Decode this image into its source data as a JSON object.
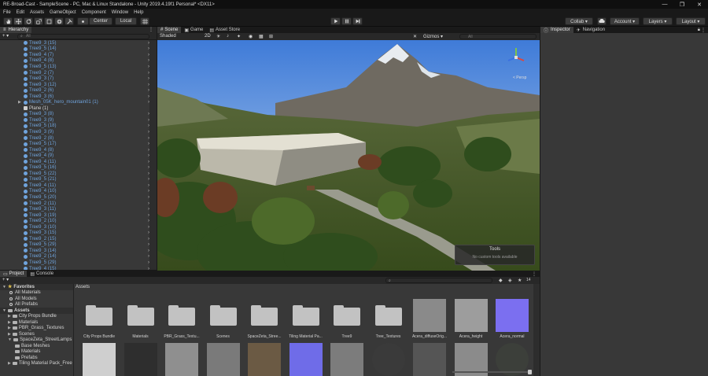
{
  "window": {
    "title": "RE-Broad-Cast - SampleScene - PC, Mac & Linux Standalone - Unity 2019.4.19f1 Personal* <DX11>",
    "controls": [
      "—",
      "❐",
      "✕"
    ]
  },
  "menu": [
    "File",
    "Edit",
    "Assets",
    "GameObject",
    "Component",
    "Window",
    "Help"
  ],
  "toolbar": {
    "center": "Center",
    "local": "Local",
    "collab": "Collab ▾",
    "account": "Account ▾",
    "layers": "Layers ▾",
    "layout": "Layout ▾"
  },
  "hierarchy": {
    "tab": "Hierarchy",
    "add": "+ ▾",
    "search_placeholder": "All",
    "items": [
      {
        "name": "Tree9_3 (15)",
        "kind": "tree"
      },
      {
        "name": "Tree9_5 (14)",
        "kind": "tree"
      },
      {
        "name": "Tree9_4 (7)",
        "kind": "tree"
      },
      {
        "name": "Tree9_4 (8)",
        "kind": "tree"
      },
      {
        "name": "Tree9_5 (13)",
        "kind": "tree"
      },
      {
        "name": "Tree9_2 (7)",
        "kind": "tree"
      },
      {
        "name": "Tree9_3 (7)",
        "kind": "tree"
      },
      {
        "name": "Tree9_3 (12)",
        "kind": "tree"
      },
      {
        "name": "Tree9_2 (6)",
        "kind": "tree"
      },
      {
        "name": "Tree9_3 (6)",
        "kind": "tree"
      },
      {
        "name": "Mesh_05K_hero_mountain01 (1)",
        "kind": "mesh"
      },
      {
        "name": "Plane (1)",
        "kind": "plane"
      },
      {
        "name": "Tree9_3 (8)",
        "kind": "tree"
      },
      {
        "name": "Tree9_3 (9)",
        "kind": "tree"
      },
      {
        "name": "Tree9_5 (18)",
        "kind": "tree"
      },
      {
        "name": "Tree9_3 (9)",
        "kind": "tree"
      },
      {
        "name": "Tree9_2 (8)",
        "kind": "tree"
      },
      {
        "name": "Tree9_5 (17)",
        "kind": "tree"
      },
      {
        "name": "Tree9_4 (8)",
        "kind": "tree"
      },
      {
        "name": "Tree9_4 (9)",
        "kind": "tree"
      },
      {
        "name": "Tree9_4 (11)",
        "kind": "tree"
      },
      {
        "name": "Tree9_5 (16)",
        "kind": "tree"
      },
      {
        "name": "Tree9_5 (22)",
        "kind": "tree"
      },
      {
        "name": "Tree9_5 (21)",
        "kind": "tree"
      },
      {
        "name": "Tree9_4 (11)",
        "kind": "tree"
      },
      {
        "name": "Tree9_4 (10)",
        "kind": "tree"
      },
      {
        "name": "Tree9_5 (20)",
        "kind": "tree"
      },
      {
        "name": "Tree9_2 (11)",
        "kind": "tree"
      },
      {
        "name": "Tree9_3 (11)",
        "kind": "tree"
      },
      {
        "name": "Tree9_3 (19)",
        "kind": "tree"
      },
      {
        "name": "Tree9_2 (10)",
        "kind": "tree"
      },
      {
        "name": "Tree9_3 (10)",
        "kind": "tree"
      },
      {
        "name": "Tree9_3 (15)",
        "kind": "tree"
      },
      {
        "name": "Tree9_2 (15)",
        "kind": "tree"
      },
      {
        "name": "Tree9_5 (29)",
        "kind": "tree"
      },
      {
        "name": "Tree9_3 (14)",
        "kind": "tree"
      },
      {
        "name": "Tree9_2 (14)",
        "kind": "tree"
      },
      {
        "name": "Tree9_5 (29)",
        "kind": "tree"
      },
      {
        "name": "Tree9_4 (15)",
        "kind": "tree"
      }
    ]
  },
  "scene": {
    "tabs": [
      "Scene",
      "Game",
      "Asset Store"
    ],
    "shading": "Shaded",
    "mode_2d": "2D",
    "gizmos": "Gizmos ▾",
    "search_placeholder": "All",
    "persp_label": "< Persp",
    "tools_overlay": {
      "title": "Tools",
      "message": "No custom tools available"
    }
  },
  "inspector": {
    "tabs": [
      "Inspector",
      "Navigation"
    ]
  },
  "project": {
    "tabs": [
      "Project",
      "Console"
    ],
    "breadcrumb": "Assets",
    "badge_count": "14",
    "tree": [
      {
        "label": "Favorites",
        "type": "favorites",
        "depth": 0
      },
      {
        "label": "All Materials",
        "type": "search",
        "depth": 1
      },
      {
        "label": "All Models",
        "type": "search",
        "depth": 1
      },
      {
        "label": "All Prefabs",
        "type": "search",
        "depth": 1
      },
      {
        "label": "Assets",
        "type": "root",
        "depth": 0
      },
      {
        "label": "City Props Bundle",
        "type": "folder",
        "depth": 1
      },
      {
        "label": "Materials",
        "type": "folder",
        "depth": 1
      },
      {
        "label": "PBR_Grass_Textures",
        "type": "folder",
        "depth": 1
      },
      {
        "label": "Scenes",
        "type": "folder",
        "depth": 1
      },
      {
        "label": "SpaceZeta_StreetLamps",
        "type": "folder",
        "depth": 1
      },
      {
        "label": "Base Meshes",
        "type": "folder",
        "depth": 2
      },
      {
        "label": "Materials",
        "type": "folder",
        "depth": 2
      },
      {
        "label": "Prefabs",
        "type": "folder",
        "depth": 2
      },
      {
        "label": "Tiling Material Pack_Free",
        "type": "folder",
        "depth": 1
      }
    ],
    "assets": [
      {
        "label": "City Props Bundle",
        "kind": "folder"
      },
      {
        "label": "Materials",
        "kind": "folder"
      },
      {
        "label": "PBR_Grass_Textu...",
        "kind": "folder"
      },
      {
        "label": "Scenes",
        "kind": "folder"
      },
      {
        "label": "SpaceZeta_Stree...",
        "kind": "folder"
      },
      {
        "label": "Tiling Material Pa...",
        "kind": "folder"
      },
      {
        "label": "Tree9",
        "kind": "folder"
      },
      {
        "label": "Tree_Textures",
        "kind": "folder"
      },
      {
        "label": "Acera_diffuseOrig...",
        "kind": "texture",
        "color": "#8a8a8a"
      },
      {
        "label": "Acera_height",
        "kind": "texture",
        "color": "#9d9d9d"
      },
      {
        "label": "Acera_normal",
        "kind": "texture",
        "color": "#7b6ff0"
      }
    ],
    "row2_colors": [
      "#cfcfcf",
      "#2e2e2e",
      "#8f8f8f",
      "#7a7a7a",
      "#6b5a44",
      "#6f6ce8",
      "#7c7c7c",
      "#3a3a3a",
      "#555555",
      "#8b8b8b",
      "#3c3f3a"
    ]
  }
}
